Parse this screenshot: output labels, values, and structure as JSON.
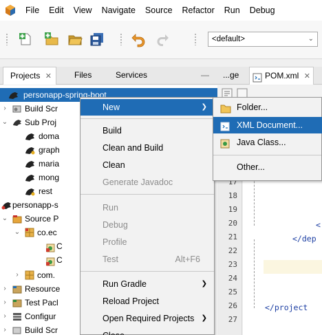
{
  "menubar": {
    "items": [
      "File",
      "Edit",
      "View",
      "Navigate",
      "Source",
      "Refactor",
      "Run",
      "Debug"
    ]
  },
  "toolbar": {
    "config_value": "<default>"
  },
  "left_tabs": {
    "projects": "Projects",
    "files": "Files",
    "services": "Services",
    "minimize": "—"
  },
  "tree": {
    "rows": [
      {
        "label": "personapp-spring-boot",
        "icon": "maven-project-icon"
      },
      {
        "label": "Build Scr",
        "icon": "build-scripts-icon"
      },
      {
        "label": "Sub Proj",
        "icon": "subprojects-icon"
      },
      {
        "label": "doma",
        "icon": "maven-module-icon"
      },
      {
        "label": "graph",
        "icon": "maven-module-icon"
      },
      {
        "label": "maria",
        "icon": "maven-module-icon"
      },
      {
        "label": "mong",
        "icon": "maven-module-icon"
      },
      {
        "label": "rest",
        "icon": "maven-module-icon"
      },
      {
        "label": "personapp-s",
        "icon": "maven-project-icon"
      },
      {
        "label": "Source P",
        "icon": "source-package-icon"
      },
      {
        "label": "co.ec",
        "icon": "java-package-icon"
      },
      {
        "label": "C",
        "icon": "java-class-icon"
      },
      {
        "label": "C",
        "icon": "java-class-icon"
      },
      {
        "label": "com.",
        "icon": "java-package-icon"
      },
      {
        "label": "Resource",
        "icon": "resources-icon"
      },
      {
        "label": "Test Pacl",
        "icon": "test-package-icon"
      },
      {
        "label": "Configur",
        "icon": "configuration-icon"
      },
      {
        "label": "Build Scr",
        "icon": "build-scripts-icon"
      }
    ]
  },
  "editor": {
    "tab1": "...ge",
    "tab2": "POM.xml",
    "line_numbers": [
      "17",
      "18",
      "19",
      "20",
      "21",
      "22",
      "23",
      "24",
      "25",
      "26",
      "27"
    ],
    "code_line_20": "<",
    "code_line_21": "</dep",
    "code_line_26": "</project"
  },
  "context_menu": {
    "items": [
      {
        "label": "New",
        "submenu": true,
        "active": true
      },
      {
        "label": "Build"
      },
      {
        "label": "Clean and Build"
      },
      {
        "label": "Clean"
      },
      {
        "label": "Generate Javadoc",
        "disabled": true
      },
      {
        "label": "Run",
        "disabled": true
      },
      {
        "label": "Debug",
        "disabled": true
      },
      {
        "label": "Profile",
        "disabled": true
      },
      {
        "label": "Test",
        "disabled": true,
        "accel": "Alt+F6"
      },
      {
        "label": "Run Gradle",
        "submenu": true
      },
      {
        "label": "Reload Project"
      },
      {
        "label": "Open Required Projects",
        "submenu": true
      },
      {
        "label": "Close"
      }
    ]
  },
  "new_submenu": {
    "items": [
      {
        "label": "Folder...",
        "icon": "folder-icon"
      },
      {
        "label": "XML Document...",
        "icon": "xml-document-icon",
        "active": true
      },
      {
        "label": "Java Class...",
        "icon": "java-class-icon"
      },
      {
        "label": "Other...",
        "icon": ""
      }
    ]
  }
}
